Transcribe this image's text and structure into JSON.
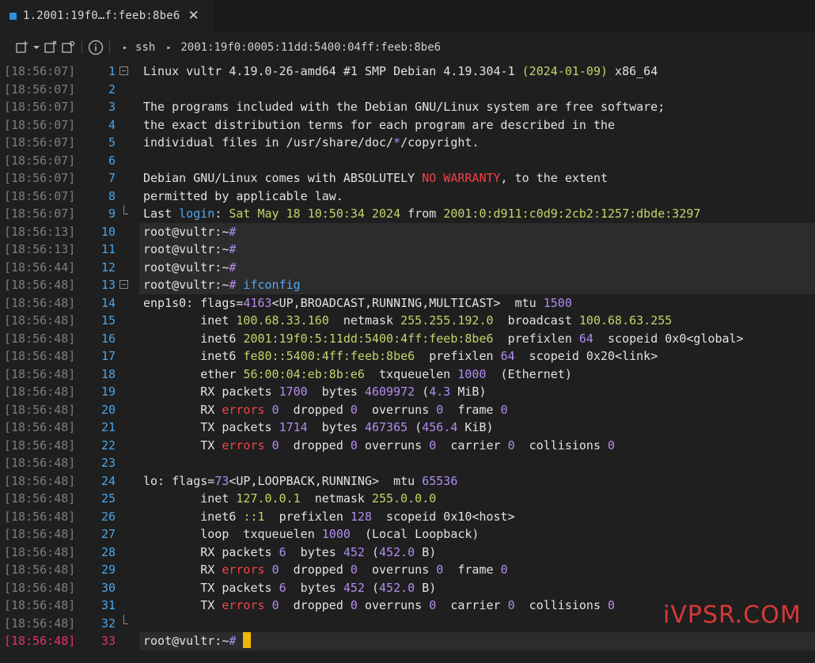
{
  "tab": {
    "title": "1.2001:19f0…f:feeb:8be6",
    "close": "✕"
  },
  "toolbar": {
    "protocol": "ssh",
    "host": "2001:19f0:0005:11dd:5400:04ff:feeb:8be6"
  },
  "terminal": {
    "lines": [
      {
        "ts": "[18:56:07]",
        "n": "1",
        "segs": [
          [
            "Linux vultr 4.19.0-26-amd64 #1 SMP Debian 4.19.304-1 ",
            ""
          ],
          [
            "(2024-01-09)",
            "green"
          ],
          [
            " x86_64",
            ""
          ]
        ]
      },
      {
        "ts": "[18:56:07]",
        "n": "2",
        "segs": []
      },
      {
        "ts": "[18:56:07]",
        "n": "3",
        "segs": [
          [
            "The programs included with the Debian GNU/Linux system are free software;",
            ""
          ]
        ]
      },
      {
        "ts": "[18:56:07]",
        "n": "4",
        "segs": [
          [
            "the exact distribution terms for each program are described in the",
            ""
          ]
        ]
      },
      {
        "ts": "[18:56:07]",
        "n": "5",
        "segs": [
          [
            "individual files in /usr/share/doc/",
            ""
          ],
          [
            "*",
            "purple"
          ],
          [
            "/copyright.",
            ""
          ]
        ]
      },
      {
        "ts": "[18:56:07]",
        "n": "6",
        "segs": []
      },
      {
        "ts": "[18:56:07]",
        "n": "7",
        "segs": [
          [
            "Debian GNU/Linux comes with ABSOLUTELY ",
            ""
          ],
          [
            "NO WARRANTY",
            "red"
          ],
          [
            ", to the extent",
            ""
          ]
        ]
      },
      {
        "ts": "[18:56:07]",
        "n": "8",
        "segs": [
          [
            "permitted by applicable law.",
            ""
          ]
        ]
      },
      {
        "ts": "[18:56:07]",
        "n": "9",
        "segs": [
          [
            "Last ",
            ""
          ],
          [
            "login",
            "blue"
          ],
          [
            ": ",
            ""
          ],
          [
            "Sat May 18 10:50:34 2024",
            "green"
          ],
          [
            " from ",
            ""
          ],
          [
            "2001:0:d911:c0d9:2cb2:1257:dbde:3297",
            "green"
          ]
        ]
      },
      {
        "ts": "[18:56:13]",
        "n": "10",
        "segs": [
          [
            "root@vultr:~",
            ""
          ],
          [
            "#",
            "purple"
          ]
        ]
      },
      {
        "ts": "[18:56:13]",
        "n": "11",
        "segs": [
          [
            "root@vultr:~",
            ""
          ],
          [
            "#",
            "purple"
          ]
        ]
      },
      {
        "ts": "[18:56:44]",
        "n": "12",
        "segs": [
          [
            "root@vultr:~",
            ""
          ],
          [
            "#",
            "purple"
          ]
        ]
      },
      {
        "ts": "[18:56:48]",
        "n": "13",
        "segs": [
          [
            "root@vultr:~",
            ""
          ],
          [
            "#",
            "purple"
          ],
          [
            " ifconfig",
            "blue"
          ]
        ]
      },
      {
        "ts": "[18:56:48]",
        "n": "14",
        "segs": [
          [
            "enp1s0: flags=",
            ""
          ],
          [
            "4163",
            "purple"
          ],
          [
            "<UP,BROADCAST,RUNNING,MULTICAST>  mtu ",
            ""
          ],
          [
            "1500",
            "purple"
          ]
        ]
      },
      {
        "ts": "[18:56:48]",
        "n": "15",
        "segs": [
          [
            "        inet ",
            ""
          ],
          [
            "100.68.33.160",
            "green"
          ],
          [
            "  netmask ",
            ""
          ],
          [
            "255.255.192.0",
            "green"
          ],
          [
            "  broadcast ",
            ""
          ],
          [
            "100.68.63.255",
            "green"
          ]
        ]
      },
      {
        "ts": "[18:56:48]",
        "n": "16",
        "segs": [
          [
            "        inet6 ",
            ""
          ],
          [
            "2001:19f0:5:11dd:5400:4ff:feeb:8be6",
            "green"
          ],
          [
            "  prefixlen ",
            ""
          ],
          [
            "64",
            "purple"
          ],
          [
            "  scopeid 0x0<global>",
            ""
          ]
        ]
      },
      {
        "ts": "[18:56:48]",
        "n": "17",
        "segs": [
          [
            "        inet6 ",
            ""
          ],
          [
            "fe80::5400:4ff:feeb:8be6",
            "green"
          ],
          [
            "  prefixlen ",
            ""
          ],
          [
            "64",
            "purple"
          ],
          [
            "  scopeid 0x20<link>",
            ""
          ]
        ]
      },
      {
        "ts": "[18:56:48]",
        "n": "18",
        "segs": [
          [
            "        ether ",
            ""
          ],
          [
            "56:00:04:eb:8b:e6",
            "green"
          ],
          [
            "  txqueuelen ",
            ""
          ],
          [
            "1000",
            "purple"
          ],
          [
            "  (Ethernet)",
            ""
          ]
        ]
      },
      {
        "ts": "[18:56:48]",
        "n": "19",
        "segs": [
          [
            "        RX packets ",
            ""
          ],
          [
            "1700",
            "purple"
          ],
          [
            "  bytes ",
            ""
          ],
          [
            "4609972",
            "purple"
          ],
          [
            " (",
            ""
          ],
          [
            "4.3",
            "purple"
          ],
          [
            " MiB)",
            ""
          ]
        ]
      },
      {
        "ts": "[18:56:48]",
        "n": "20",
        "segs": [
          [
            "        RX ",
            ""
          ],
          [
            "errors",
            "red"
          ],
          [
            " ",
            ""
          ],
          [
            "0",
            "purple"
          ],
          [
            "  dropped ",
            ""
          ],
          [
            "0",
            "purple"
          ],
          [
            "  overruns ",
            ""
          ],
          [
            "0",
            "purple"
          ],
          [
            "  frame ",
            ""
          ],
          [
            "0",
            "purple"
          ]
        ]
      },
      {
        "ts": "[18:56:48]",
        "n": "21",
        "segs": [
          [
            "        TX packets ",
            ""
          ],
          [
            "1714",
            "purple"
          ],
          [
            "  bytes ",
            ""
          ],
          [
            "467365",
            "purple"
          ],
          [
            " (",
            ""
          ],
          [
            "456.4",
            "purple"
          ],
          [
            " KiB)",
            ""
          ]
        ]
      },
      {
        "ts": "[18:56:48]",
        "n": "22",
        "segs": [
          [
            "        TX ",
            ""
          ],
          [
            "errors",
            "red"
          ],
          [
            " ",
            ""
          ],
          [
            "0",
            "purple"
          ],
          [
            "  dropped ",
            ""
          ],
          [
            "0",
            "purple"
          ],
          [
            " overruns ",
            ""
          ],
          [
            "0",
            "purple"
          ],
          [
            "  carrier ",
            ""
          ],
          [
            "0",
            "purple"
          ],
          [
            "  collisions ",
            ""
          ],
          [
            "0",
            "purple"
          ]
        ]
      },
      {
        "ts": "[18:56:48]",
        "n": "23",
        "segs": []
      },
      {
        "ts": "[18:56:48]",
        "n": "24",
        "segs": [
          [
            "lo: flags=",
            ""
          ],
          [
            "73",
            "purple"
          ],
          [
            "<UP,LOOPBACK,RUNNING>  mtu ",
            ""
          ],
          [
            "65536",
            "purple"
          ]
        ]
      },
      {
        "ts": "[18:56:48]",
        "n": "25",
        "segs": [
          [
            "        inet ",
            ""
          ],
          [
            "127.0.0.1",
            "green"
          ],
          [
            "  netmask ",
            ""
          ],
          [
            "255.0.0.0",
            "green"
          ]
        ]
      },
      {
        "ts": "[18:56:48]",
        "n": "26",
        "segs": [
          [
            "        inet6 ",
            ""
          ],
          [
            "::1",
            "green"
          ],
          [
            "  prefixlen ",
            ""
          ],
          [
            "128",
            "purple"
          ],
          [
            "  scopeid 0x10<host>",
            ""
          ]
        ]
      },
      {
        "ts": "[18:56:48]",
        "n": "27",
        "segs": [
          [
            "        loop  txqueuelen ",
            ""
          ],
          [
            "1000",
            "purple"
          ],
          [
            "  (Local Loopback)",
            ""
          ]
        ]
      },
      {
        "ts": "[18:56:48]",
        "n": "28",
        "segs": [
          [
            "        RX packets ",
            ""
          ],
          [
            "6",
            "purple"
          ],
          [
            "  bytes ",
            ""
          ],
          [
            "452",
            "purple"
          ],
          [
            " (",
            ""
          ],
          [
            "452.0",
            "purple"
          ],
          [
            " B)",
            ""
          ]
        ]
      },
      {
        "ts": "[18:56:48]",
        "n": "29",
        "segs": [
          [
            "        RX ",
            ""
          ],
          [
            "errors",
            "red"
          ],
          [
            " ",
            ""
          ],
          [
            "0",
            "purple"
          ],
          [
            "  dropped ",
            ""
          ],
          [
            "0",
            "purple"
          ],
          [
            "  overruns ",
            ""
          ],
          [
            "0",
            "purple"
          ],
          [
            "  frame ",
            ""
          ],
          [
            "0",
            "purple"
          ]
        ]
      },
      {
        "ts": "[18:56:48]",
        "n": "30",
        "segs": [
          [
            "        TX packets ",
            ""
          ],
          [
            "6",
            "purple"
          ],
          [
            "  bytes ",
            ""
          ],
          [
            "452",
            "purple"
          ],
          [
            " (",
            ""
          ],
          [
            "452.0",
            "purple"
          ],
          [
            " B)",
            ""
          ]
        ]
      },
      {
        "ts": "[18:56:48]",
        "n": "31",
        "segs": [
          [
            "        TX ",
            ""
          ],
          [
            "errors",
            "red"
          ],
          [
            " ",
            ""
          ],
          [
            "0",
            "purple"
          ],
          [
            "  dropped ",
            ""
          ],
          [
            "0",
            "purple"
          ],
          [
            " overruns ",
            ""
          ],
          [
            "0",
            "purple"
          ],
          [
            "  carrier ",
            ""
          ],
          [
            "0",
            "purple"
          ],
          [
            "  collisions ",
            ""
          ],
          [
            "0",
            "purple"
          ]
        ]
      },
      {
        "ts": "[18:56:48]",
        "n": "32",
        "segs": []
      },
      {
        "ts": "[18:56:48]",
        "n": "33",
        "segs": [
          [
            "root@vultr:~",
            ""
          ],
          [
            "#",
            "purple"
          ],
          [
            " ",
            ""
          ]
        ]
      }
    ]
  },
  "watermark": "iVPSR.COM",
  "colors": {
    "purple": "#b38cf0",
    "green": "#c6d36a",
    "blue": "#5aa7ee",
    "red": "#f0424a",
    "cursor": "#f2b705",
    "active": "#e0336f"
  }
}
